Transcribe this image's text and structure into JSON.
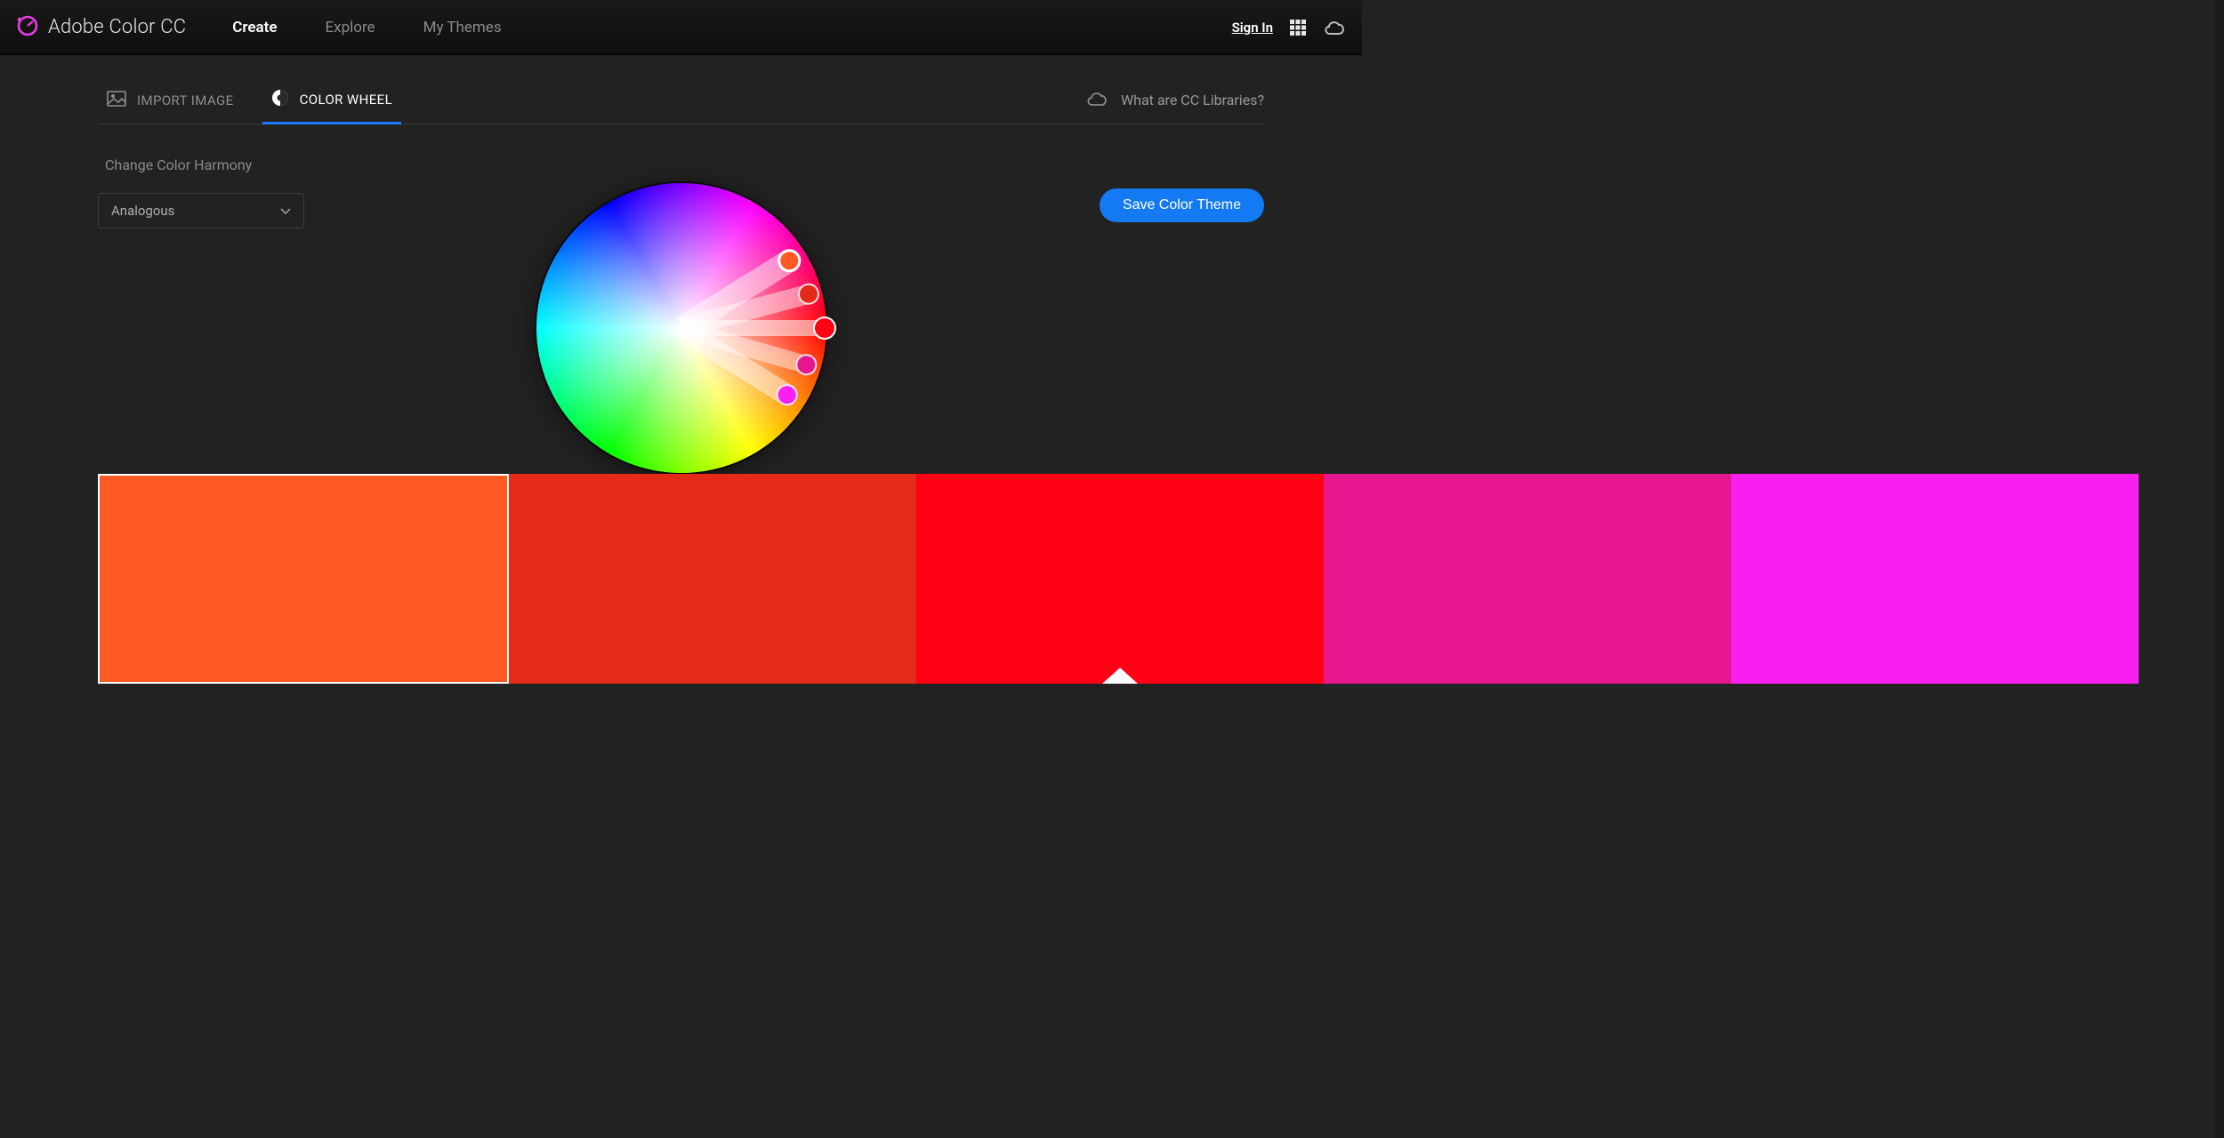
{
  "header": {
    "brand": "Adobe Color CC",
    "nav": {
      "create": "Create",
      "explore": "Explore",
      "mythemes": "My Themes"
    },
    "signin": "Sign In"
  },
  "tabs": {
    "import": "IMPORT IMAGE",
    "wheel": "COLOR WHEEL"
  },
  "helpLink": "What are CC Libraries?",
  "harmony": {
    "label": "Change Color Harmony",
    "selected": "Analogous"
  },
  "saveButton": "Save Color Theme",
  "swatches": [
    {
      "hex": "#ff5a25",
      "selected": true,
      "base": false
    },
    {
      "hex": "#e62a1a",
      "selected": false,
      "base": false
    },
    {
      "hex": "#ff0015",
      "selected": false,
      "base": true
    },
    {
      "hex": "#e6178e",
      "selected": false,
      "base": false
    },
    {
      "hex": "#f81ff0",
      "selected": false,
      "base": false
    }
  ]
}
